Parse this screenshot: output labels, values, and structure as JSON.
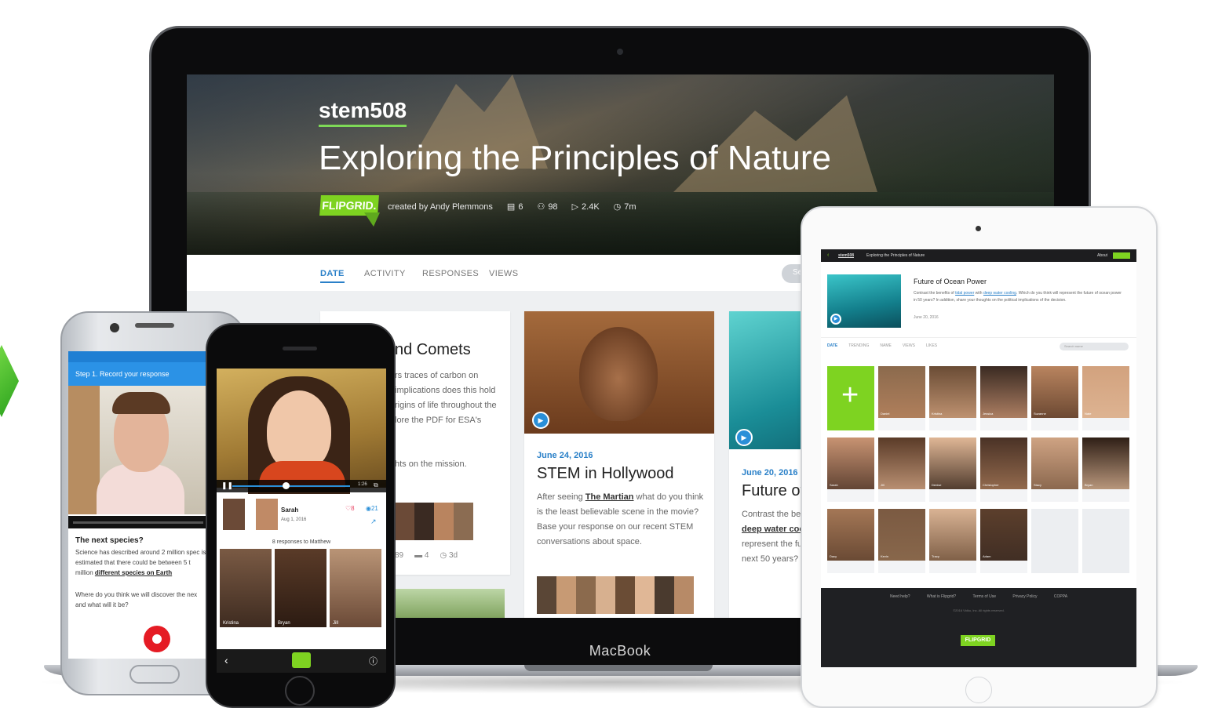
{
  "colors": {
    "accent_green": "#7ed321",
    "link_blue": "#2a80c8",
    "record_red": "#e51b24"
  },
  "laptop": {
    "brand": "MacBook",
    "hero": {
      "owner": "stem508",
      "title": "Exploring the Principles of Nature",
      "logo": "FLIPGRID.",
      "created_by": "created by Andy Plemmons",
      "stats": {
        "topics": "6",
        "members": "98",
        "views": "2.4K",
        "time": "7m"
      }
    },
    "tabs": [
      "DATE",
      "ACTIVITY",
      "RESPONSES",
      "VIEWS"
    ],
    "search_placeholder": "Se",
    "cards": [
      {
        "title": "nd Comets",
        "body": "rs traces of carbon on implications does this hold rigins of life throughout the lore the PDF for ESA's",
        "body2": "hts on the mission.",
        "stats": {
          "views": "89",
          "comments": "4",
          "age": "3d"
        }
      },
      {
        "date": "June 24, 2016",
        "title": "STEM in Hollywood",
        "body_pre": "After seeing ",
        "body_link": "The Martian",
        "body_post": " what do you think is the least believable scene in the movie? Base your response on our recent STEM conversations about space."
      },
      {
        "date": "June 20, 2016",
        "title": "Future of",
        "body_pre": "Contrast the ber",
        "body_link": "deep water coc",
        "body_post": "represent the fu next 50 years?"
      }
    ]
  },
  "android": {
    "step_label": "Step 1. Record your response",
    "question_title": "The next species?",
    "question_text": "Science has described around 2 million spec is estimated that there could be between 5 t million ",
    "question_link": "different species on Earth",
    "question_text2": "Where do you think we will discover the nex and what will it be?"
  },
  "iphone": {
    "video_time": "1:26",
    "user_name": "Sarah",
    "user_date": "Aug 1, 2016",
    "likes": "8",
    "views": "21",
    "responses_label": "8 responses to Matthew",
    "tiles": [
      "Kristina",
      "Bryan",
      "Jill"
    ]
  },
  "ipad": {
    "nav_owner": "stem508",
    "nav_title": "Exploring the Principles of Nature",
    "nav_about": "About",
    "featured_title": "Future of Ocean Power",
    "featured_text_pre": "Contrast the benefits of ",
    "featured_link1": "tidal power",
    "featured_text_mid": " with ",
    "featured_link2": "deep water cooling",
    "featured_text_post": ". Which do you think will represent the future of ocean power in 50 years? In addition, share your thoughts on the political implications of the decision.",
    "featured_date": "June 20, 2016",
    "tabs": [
      "DATE",
      "TRENDING",
      "NAME",
      "VIEWS",
      "LIKES"
    ],
    "search_placeholder": "Search name",
    "tiles": [
      "Daniel",
      "Kristina",
      "Jessica",
      "Suzanne",
      "Nate",
      "Sarah",
      "Jill",
      "Denise",
      "Christopher",
      "Stacy",
      "Bryan",
      "Dacy",
      "Kevin",
      "Tracy",
      "Adam"
    ],
    "footer_links": [
      "Need help?",
      "What is Flipgrid?",
      "Terms of Use",
      "Privacy Policy",
      "COPPA"
    ],
    "footer_copy": "©2016 Vidku, Inc. All rights reserved.",
    "footer_logo": "FLIPGRID"
  }
}
